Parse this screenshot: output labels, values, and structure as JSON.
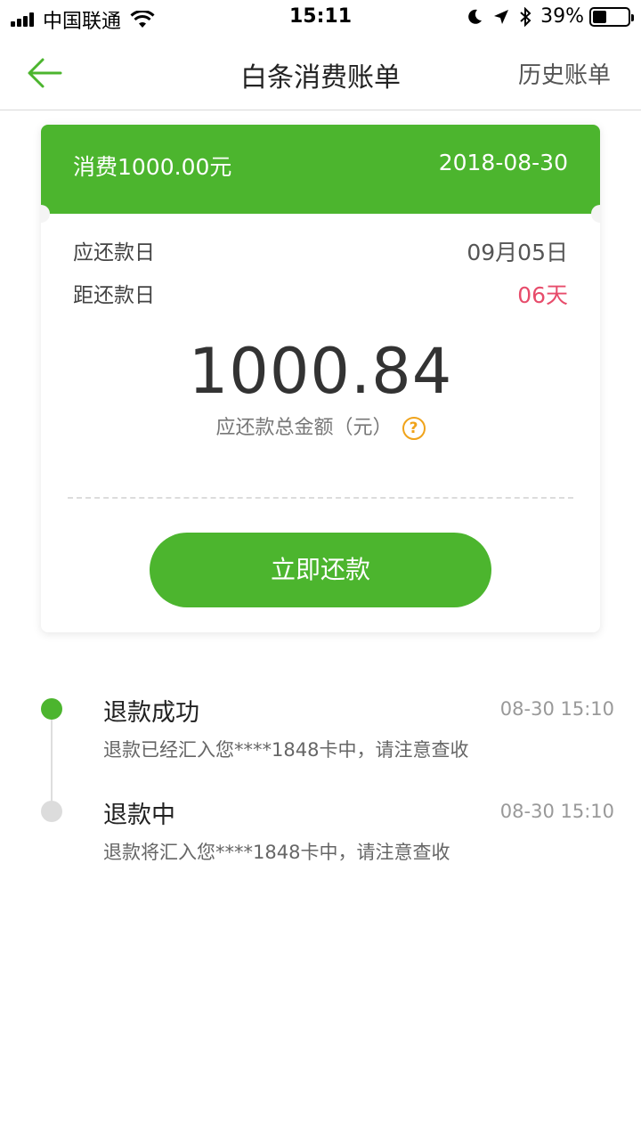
{
  "status_bar": {
    "carrier": "中国联通",
    "time": "15:11",
    "battery_pct": "39%",
    "battery_level": 0.39,
    "icons": [
      "signal-icon",
      "wifi-icon",
      "moon-icon",
      "location-arrow-icon",
      "bluetooth-icon",
      "battery-icon"
    ]
  },
  "nav": {
    "back_icon": "back-arrow-icon",
    "title": "白条消费账单",
    "history": "历史账单"
  },
  "bill": {
    "spend_label": "消费1000.00元",
    "spend_date": "2018-08-30",
    "due_label": "应还款日",
    "due_value": "09月05日",
    "days_label": "距还款日",
    "days_value": "06天",
    "amount": "1000.84",
    "amount_label": "应还款总金额（元）",
    "help_icon": "?",
    "repay_button": "立即还款"
  },
  "timeline": [
    {
      "title": "退款成功",
      "time": "08-30 15:10",
      "desc": "退款已经汇入您****1848卡中，请注意查收",
      "status": "done"
    },
    {
      "title": "退款中",
      "time": "08-30 15:10",
      "desc": "退款将汇入您****1848卡中，请注意查收",
      "status": "pending"
    }
  ],
  "colors": {
    "accent": "#4cb52e",
    "warning": "#e74c6b",
    "help": "#f0a31a"
  }
}
